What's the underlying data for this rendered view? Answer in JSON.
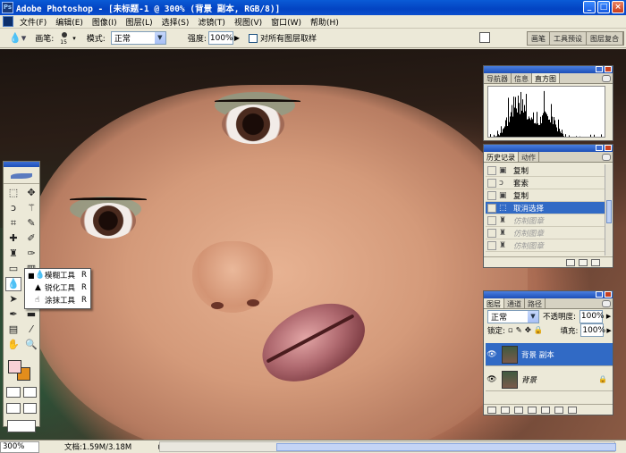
{
  "app": {
    "title": "Adobe Photoshop - [未标题-1 @ 300% (背景 副本, RGB/8)]",
    "icon_text": "Ps"
  },
  "window_buttons": [
    "_",
    "□",
    "×"
  ],
  "menu": [
    "文件(F)",
    "编辑(E)",
    "图像(I)",
    "图层(L)",
    "选择(S)",
    "滤镜(T)",
    "视图(V)",
    "窗口(W)",
    "帮助(H)"
  ],
  "options": {
    "brush_label": "画笔:",
    "brush_size": "15",
    "mode_label": "模式:",
    "mode_value": "正常",
    "strength_label": "强度:",
    "strength_value": "100%",
    "sample_all_label": "对所有图层取样",
    "sample_all_checked": false
  },
  "palette_well": [
    "画笔",
    "工具预设",
    "图层复合"
  ],
  "tool_flyout": [
    {
      "label": "模糊工具",
      "key": "R",
      "icon": "blur-drop-icon",
      "current": true
    },
    {
      "label": "锐化工具",
      "key": "R",
      "icon": "sharpen-triangle-icon",
      "current": false
    },
    {
      "label": "涂抹工具",
      "key": "R",
      "icon": "smudge-finger-icon",
      "current": false
    }
  ],
  "colors": {
    "foreground": "#f8d0d6",
    "background": "#e28d1c"
  },
  "navigator_panel": {
    "tabs": [
      "导航器",
      "信息",
      "直方图"
    ],
    "active_tab": "直方图"
  },
  "history_panel": {
    "tabs": [
      "历史记录",
      "动作"
    ],
    "active_tab": "历史记录",
    "items": [
      {
        "label": "复制",
        "state": "normal"
      },
      {
        "label": "套索",
        "state": "normal"
      },
      {
        "label": "复制",
        "state": "normal"
      },
      {
        "label": "取消选择",
        "state": "selected"
      },
      {
        "label": "仿制图章",
        "state": "dimmed"
      },
      {
        "label": "仿制图章",
        "state": "dimmed"
      },
      {
        "label": "仿制图章",
        "state": "dimmed"
      },
      {
        "label": "仿制图章",
        "state": "dimmed"
      }
    ]
  },
  "layers_panel": {
    "tabs": [
      "图层",
      "通道",
      "路径"
    ],
    "active_tab": "图层",
    "blend_mode": "正常",
    "opacity_label": "不透明度:",
    "opacity_value": "100%",
    "lock_label": "锁定:",
    "fill_label": "填充:",
    "fill_value": "100%",
    "layers": [
      {
        "name": "背景 副本",
        "selected": true,
        "locked": false
      },
      {
        "name": "背景",
        "selected": false,
        "locked": true
      }
    ]
  },
  "status": {
    "zoom": "300%",
    "doc_info": "文档:1.59M/3.18M"
  }
}
